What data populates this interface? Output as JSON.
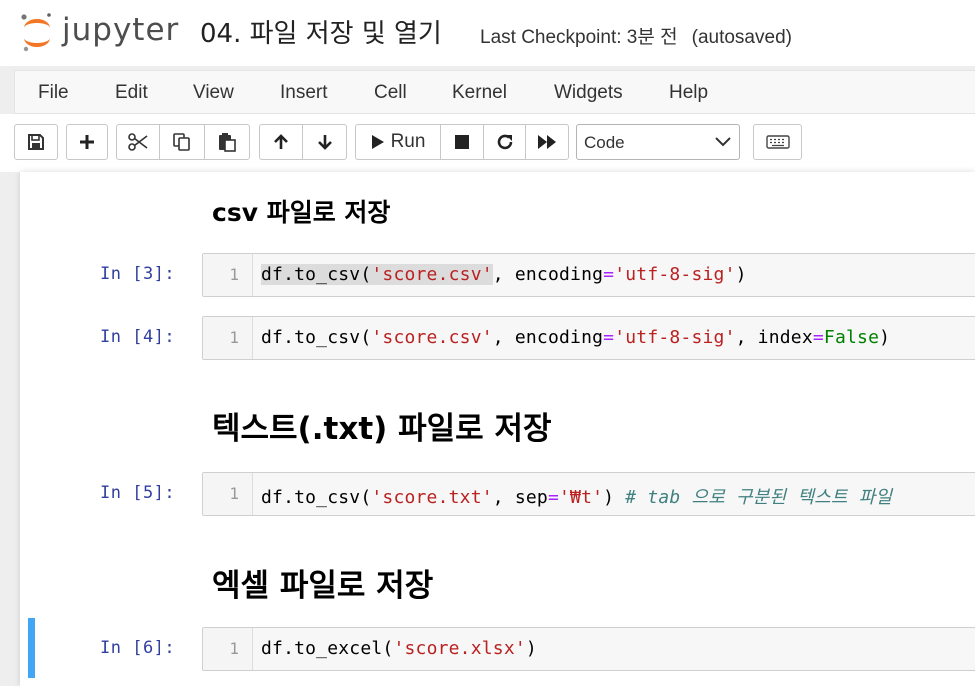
{
  "header": {
    "brand": "jupyter",
    "notebook_title": "04. 파일 저장 및 열기",
    "checkpoint": "Last Checkpoint: 3분 전",
    "autosave": "(autosaved)"
  },
  "menu": [
    "File",
    "Edit",
    "View",
    "Insert",
    "Cell",
    "Kernel",
    "Widgets",
    "Help"
  ],
  "toolbar": {
    "run_label": "Run",
    "cell_type": "Code",
    "icons": [
      "save-icon",
      "plus-icon",
      "scissors-icon",
      "copy-icon",
      "paste-icon",
      "arrow-up-icon",
      "arrow-down-icon",
      "play-icon",
      "stop-icon",
      "restart-icon",
      "fast-forward-icon",
      "chevron-down-icon",
      "keyboard-icon"
    ]
  },
  "cells": {
    "md1": "csv 파일로 저장",
    "c3": {
      "prompt": "In [3]:",
      "line": "1",
      "t1": "df.to_csv(",
      "t2": "'score.csv'",
      "t3": ", encoding",
      "t4": "=",
      "t5": "'utf-8-sig'",
      "t6": ")"
    },
    "c4": {
      "prompt": "In [4]:",
      "line": "1",
      "t1": "df.to_csv(",
      "t2": "'score.csv'",
      "t3": ", encoding",
      "t4": "=",
      "t5": "'utf-8-sig'",
      "t6": ", index",
      "t7": "=",
      "t8": "False",
      "t9": ")"
    },
    "md2": "텍스트(.txt) 파일로 저장",
    "c5": {
      "prompt": "In [5]:",
      "line": "1",
      "t1": "df.to_csv(",
      "t2": "'score.txt'",
      "t3": ", sep",
      "t4": "=",
      "t5": "'₩t'",
      "t6": ") ",
      "t7": "# tab 으로 구분된 텍스트 파일"
    },
    "md3": "엑셀 파일로 저장",
    "c6": {
      "prompt": "In [6]:",
      "line": "1",
      "t1": "df.to_excel(",
      "t2": "'score.xlsx'",
      "t3": ")"
    }
  },
  "colors": {
    "string": "#ba2121",
    "operator": "#aa22ff",
    "keyword": "#008000",
    "comment": "#408080",
    "prompt": "#303f9f",
    "active_cell": "#42a5f5",
    "logo_orange": "#f37626"
  }
}
